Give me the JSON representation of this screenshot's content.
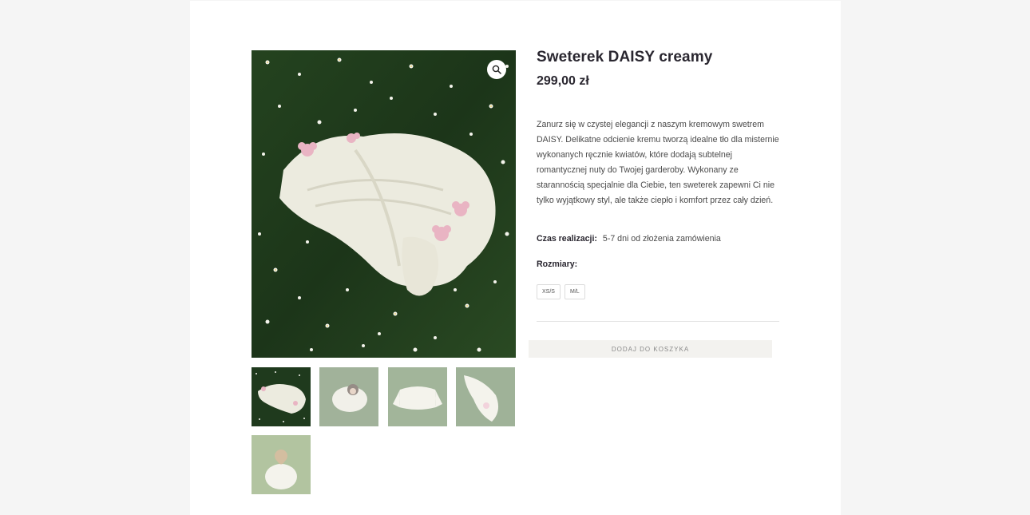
{
  "product": {
    "title": "Sweterek DAISY creamy",
    "price": "299,00 zł",
    "description": "Zanurz się w czystej elegancji z naszym kremowym swetrem DAISY. Delikatne odcienie kremu tworzą idealne tło dla misternie wykonanych ręcznie kwiatów, które dodają subtelnej romantycznej nuty do Twojej garderoby. Wykonany ze starannością specjalnie dla Ciebie, ten sweterek zapewni Ci nie tylko wyjątkowy styl, ale także ciepło i komfort przez cały dzień.",
    "lead_time_label": "Czas realizacji:",
    "lead_time_value": "5-7 dni od złożenia zamówienia",
    "sizes_label": "Rozmiary:",
    "sizes": [
      "XS/S",
      "M/L"
    ],
    "add_to_cart_label": "DODAJ DO KOSZYKA"
  },
  "gallery": {
    "zoom_icon": "magnifier-icon",
    "main_image": "cream knitted cardigan with pink crochet flowers lying on grass with daisies",
    "thumbnails": [
      "cardigan on grass",
      "woman lying in grass wearing cardigan",
      "cardigan laid flat on grass",
      "cardigan sleeve with flower on grass",
      "woman seen from behind sitting in grass"
    ]
  },
  "colors": {
    "page_bg": "#f5f5f5",
    "content_bg": "#ffffff",
    "title": "#2a2730",
    "text": "#4a4a4a",
    "button_bg": "#f3f2ef",
    "button_text": "#8a8a8a",
    "grass": "#1f3a1d"
  }
}
